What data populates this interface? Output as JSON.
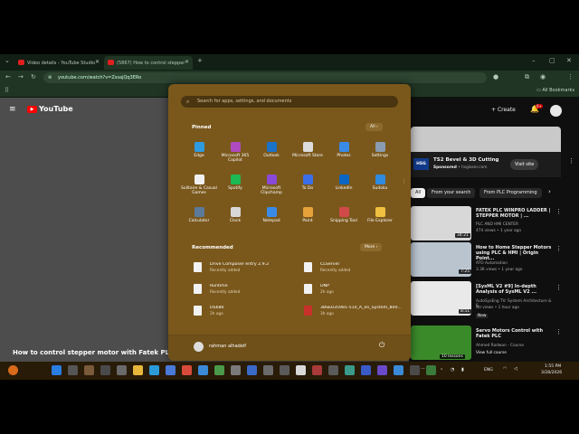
{
  "browser": {
    "tabs": [
      {
        "label": "Video details - YouTube Studio"
      },
      {
        "label": "(5867) How to control stepper"
      }
    ],
    "new_tab": "+",
    "url": "youtube.com/watch?v=ZssajQq3ERo",
    "all_bookmarks": "All Bookmarks",
    "window_controls": [
      "–",
      "▢",
      "✕"
    ]
  },
  "youtube": {
    "logo": "YouTube",
    "create": "Create",
    "notif_count": "9+",
    "video_title": "How to control stepper motor with Fatek PLC ?",
    "ad": {
      "title": "TS2 Bevel & 3D Cutting",
      "sponsored": "Sponsored",
      "dot": "•",
      "site": "hsglaser.com",
      "visit": "Visit site",
      "logo": "HSG"
    },
    "chips": [
      "All",
      "From your search",
      "From PLC Programming"
    ],
    "videos": [
      {
        "title": "FATEK PLC WINPRO LADDER | STEPPER MOTOR | ...",
        "channel": "PLC AND HMI CENTER",
        "meta": "474 views • 1 year ago",
        "duration": "34:21",
        "badge": ""
      },
      {
        "title": "How to Home Stepper Motors using PLC & HMI | Origin Point...",
        "channel": "ATO Automation",
        "meta": "3.3K views • 1 year ago",
        "duration": "7:25",
        "badge": ""
      },
      {
        "title": "[SysML V2 #9] In-depth Analysis of SysML V2 ...",
        "channel": "AutoSysEng TV: System Architecture & S...",
        "meta": "No views • 1 hour ago",
        "duration": "8:51",
        "badge": "New"
      },
      {
        "title": "Servo Motors Control with Fatek PLC",
        "channel": "Ahmed Radwan - Course",
        "meta": "View full course",
        "duration": "10 lessons",
        "badge": ""
      }
    ]
  },
  "start_menu": {
    "search_placeholder": "Search for apps, settings, and documents",
    "pinned_title": "Pinned",
    "all_button": "All  ›",
    "pinned": [
      {
        "label": "Edge",
        "color": "#2f9be0"
      },
      {
        "label": "Microsoft 365 Copilot",
        "color": "#b04ac0"
      },
      {
        "label": "Outlook",
        "color": "#1a73c8"
      },
      {
        "label": "Microsoft Store",
        "color": "#dcdcdc"
      },
      {
        "label": "Photos",
        "color": "#3a8be8"
      },
      {
        "label": "Settings",
        "color": "#8a9cb0"
      },
      {
        "label": "Solitaire & Casual Games",
        "color": "#f0f0f0"
      },
      {
        "label": "Spotify",
        "color": "#1db954"
      },
      {
        "label": "Microsoft Clipchamp",
        "color": "#8a4ad8"
      },
      {
        "label": "To Do",
        "color": "#3b6ee8"
      },
      {
        "label": "LinkedIn",
        "color": "#0a66c2"
      },
      {
        "label": "Sudoku",
        "color": "#2e8be0"
      },
      {
        "label": "Calculator",
        "color": "#5c7a9a"
      },
      {
        "label": "Clock",
        "color": "#d8d8d8"
      },
      {
        "label": "Notepad",
        "color": "#3a8be8"
      },
      {
        "label": "Paint",
        "color": "#e8a23a"
      },
      {
        "label": "Snipping Tool",
        "color": "#d04a4a"
      },
      {
        "label": "File Explorer",
        "color": "#f0c040"
      }
    ],
    "recommended_title": "Recommended",
    "more_button": "More  ›",
    "recommended": [
      {
        "name": "Drive Composer entry 2.9.2",
        "sub": "Recently added"
      },
      {
        "name": "CLServer",
        "sub": "Recently added"
      },
      {
        "name": "Runtime",
        "sub": "Recently added"
      },
      {
        "name": "DNP",
        "sub": "2h ago"
      },
      {
        "name": "DS680",
        "sub": "2h ago"
      },
      {
        "name": "3BSE035981-510_A_en_System_800...",
        "sub": "3h ago"
      }
    ],
    "user": "rahman alhadeif",
    "power": "⏻"
  },
  "taskbar": {
    "lang": "ENG",
    "time": "1:55 PM",
    "date": "3/28/2026",
    "more": "⋯"
  }
}
